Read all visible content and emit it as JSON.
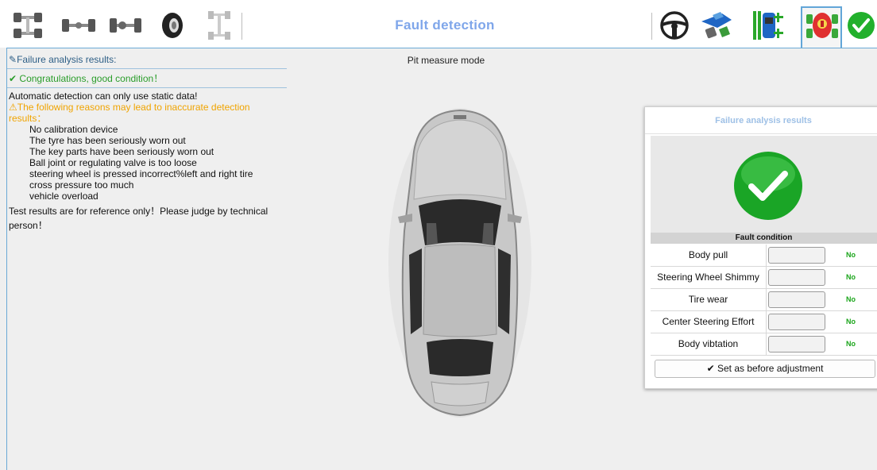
{
  "toolbar": {
    "title": "Fault detection",
    "icons": [
      "car-frame-icon",
      "axle-icon",
      "wheel-axle-icon",
      "tire-icon",
      "chassis-icon",
      "steering-wheel-icon",
      "car-tilt-icon",
      "wheel-alignment-icon",
      "fault-detection-icon",
      "check-confirm-icon"
    ]
  },
  "left": {
    "header": "Failure analysis results:",
    "ok_message": "Congratulations, good condition！",
    "static_note": "Automatic detection can only use static data!",
    "warning": "The following reasons may lead to inaccurate detection results：",
    "reasons": [
      "No calibration device",
      "The tyre has been seriously worn out",
      "The key parts have been seriously worn out",
      "Ball joint or regulating valve is too loose",
      "steering wheel is pressed incorrect%left and right tire",
      "cross pressure too much",
      "vehicle overload"
    ],
    "footer": "Test results are for reference only！Please judge by technical person！"
  },
  "center": {
    "mode": "Pit measure mode"
  },
  "panel": {
    "title": "Failure analysis results",
    "section_header": "Fault condition",
    "rows": [
      {
        "label": "Body pull",
        "value": "No"
      },
      {
        "label": "Steering Wheel Shimmy",
        "value": "No"
      },
      {
        "label": "Tire wear",
        "value": "No"
      },
      {
        "label": "Center Steering Effort",
        "value": "No"
      },
      {
        "label": "Body vibtation",
        "value": "No"
      }
    ],
    "button": "Set as before adjustment"
  },
  "colors": {
    "accent": "#62a6d8",
    "ok_green": "#2a9d2a",
    "warning": "#f0a400",
    "title_blue": "#7fa6ea"
  }
}
